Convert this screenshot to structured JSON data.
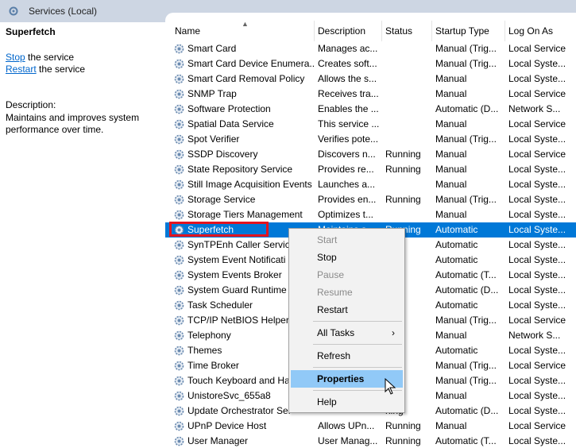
{
  "window": {
    "title": "Services (Local)"
  },
  "left_pane": {
    "service_name": "Superfetch",
    "stop_link": "Stop",
    "stop_suffix": " the service",
    "restart_link": "Restart",
    "restart_suffix": " the service",
    "description_label": "Description:",
    "description_text": "Maintains and improves system performance over time."
  },
  "columns": [
    "Name",
    "Description",
    "Status",
    "Startup Type",
    "Log On As"
  ],
  "rows": [
    {
      "name": "Smart Card",
      "desc": "Manages ac...",
      "status": "",
      "startup": "Manual (Trig...",
      "logon": "Local Service"
    },
    {
      "name": "Smart Card Device Enumera...",
      "desc": "Creates soft...",
      "status": "",
      "startup": "Manual (Trig...",
      "logon": "Local Syste..."
    },
    {
      "name": "Smart Card Removal Policy",
      "desc": "Allows the s...",
      "status": "",
      "startup": "Manual",
      "logon": "Local Syste..."
    },
    {
      "name": "SNMP Trap",
      "desc": "Receives tra...",
      "status": "",
      "startup": "Manual",
      "logon": "Local Service"
    },
    {
      "name": "Software Protection",
      "desc": "Enables the ...",
      "status": "",
      "startup": "Automatic (D...",
      "logon": "Network S..."
    },
    {
      "name": "Spatial Data Service",
      "desc": "This service ...",
      "status": "",
      "startup": "Manual",
      "logon": "Local Service"
    },
    {
      "name": "Spot Verifier",
      "desc": "Verifies pote...",
      "status": "",
      "startup": "Manual (Trig...",
      "logon": "Local Syste..."
    },
    {
      "name": "SSDP Discovery",
      "desc": "Discovers n...",
      "status": "Running",
      "startup": "Manual",
      "logon": "Local Service"
    },
    {
      "name": "State Repository Service",
      "desc": "Provides re...",
      "status": "Running",
      "startup": "Manual",
      "logon": "Local Syste..."
    },
    {
      "name": "Still Image Acquisition Events",
      "desc": "Launches a...",
      "status": "",
      "startup": "Manual",
      "logon": "Local Syste..."
    },
    {
      "name": "Storage Service",
      "desc": "Provides en...",
      "status": "Running",
      "startup": "Manual (Trig...",
      "logon": "Local Syste..."
    },
    {
      "name": "Storage Tiers Management",
      "desc": "Optimizes t...",
      "status": "",
      "startup": "Manual",
      "logon": "Local Syste..."
    },
    {
      "name": "Superfetch",
      "desc": "Maintains a...",
      "status": "Running",
      "startup": "Automatic",
      "logon": "Local Syste...",
      "selected": true
    },
    {
      "name": "SynTPEnh Caller Service",
      "desc": "",
      "status": "ning",
      "startup": "Automatic",
      "logon": "Local Syste..."
    },
    {
      "name": "System Event Notificati",
      "desc": "",
      "status": "ning",
      "startup": "Automatic",
      "logon": "Local Syste..."
    },
    {
      "name": "System Events Broker",
      "desc": "",
      "status": "ning",
      "startup": "Automatic (T...",
      "logon": "Local Syste..."
    },
    {
      "name": "System Guard Runtime M",
      "desc": "",
      "status": "ning",
      "startup": "Automatic (D...",
      "logon": "Local Syste..."
    },
    {
      "name": "Task Scheduler",
      "desc": "",
      "status": "ning",
      "startup": "Automatic",
      "logon": "Local Syste..."
    },
    {
      "name": "TCP/IP NetBIOS Helper",
      "desc": "",
      "status": "ning",
      "startup": "Manual (Trig...",
      "logon": "Local Service"
    },
    {
      "name": "Telephony",
      "desc": "",
      "status": "",
      "startup": "Manual",
      "logon": "Network S..."
    },
    {
      "name": "Themes",
      "desc": "",
      "status": "ning",
      "startup": "Automatic",
      "logon": "Local Syste..."
    },
    {
      "name": "Time Broker",
      "desc": "",
      "status": "ning",
      "startup": "Manual (Trig...",
      "logon": "Local Service"
    },
    {
      "name": "Touch Keyboard and Ha",
      "desc": "",
      "status": "ning",
      "startup": "Manual (Trig...",
      "logon": "Local Syste..."
    },
    {
      "name": "UnistoreSvc_655a8",
      "desc": "",
      "status": "ning",
      "startup": "Manual",
      "logon": "Local Syste..."
    },
    {
      "name": "Update Orchestrator Ser",
      "desc": "",
      "status": "ning",
      "startup": "Automatic (D...",
      "logon": "Local Syste..."
    },
    {
      "name": "UPnP Device Host",
      "desc": "Allows UPn...",
      "status": "Running",
      "startup": "Manual",
      "logon": "Local Service"
    },
    {
      "name": "User Manager",
      "desc": "User Manag...",
      "status": "Running",
      "startup": "Automatic (T...",
      "logon": "Local Syste..."
    }
  ],
  "context_menu": {
    "items": [
      {
        "label": "Start",
        "disabled": true
      },
      {
        "label": "Stop",
        "disabled": false
      },
      {
        "label": "Pause",
        "disabled": true
      },
      {
        "label": "Resume",
        "disabled": true
      },
      {
        "label": "Restart",
        "disabled": false
      },
      {
        "label": "All Tasks",
        "disabled": false,
        "submenu": true
      },
      {
        "label": "Refresh",
        "disabled": false
      },
      {
        "label": "Properties",
        "disabled": false,
        "hovered": true
      },
      {
        "label": "Help",
        "disabled": false
      }
    ],
    "submenu_arrow": "›"
  },
  "colors": {
    "selection": "#0078d7",
    "menu_hover": "#91c9f7",
    "highlight_box": "#e3141f",
    "link": "#0066cc"
  }
}
